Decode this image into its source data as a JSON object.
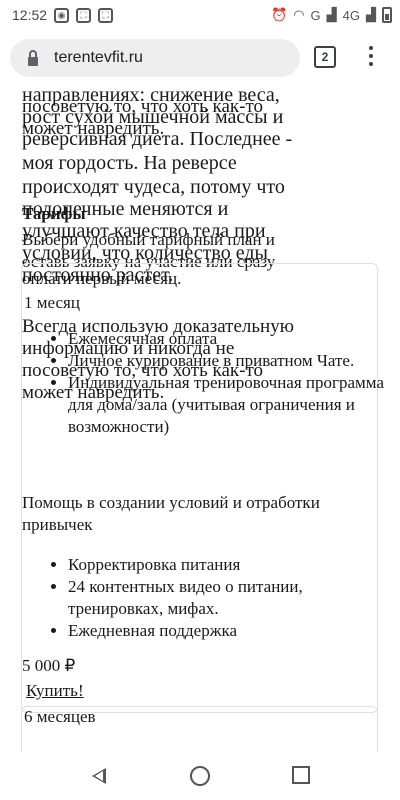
{
  "status_bar": {
    "time": "12:52",
    "carrier_label": "4G",
    "network_label": "G"
  },
  "browser": {
    "url": "terentevfit.ru",
    "tab_count": "2"
  },
  "content": {
    "intro_line_1": "направлениях: снижение веса,",
    "intro_line_2": "рост сухой мышечной массы и",
    "intro_line_3": "реверсивная диета. Последнее -",
    "intro_line_4": "моя гордость. На реверсе",
    "intro_line_5": "происходят чудеса, потому что",
    "intro_line_6": "подопечные меняются и",
    "intro_line_7": "улучшают качество тела при",
    "intro_line_8": "условии, что количество еды",
    "intro_line_9": "постоянно растет.",
    "overlap_1": "посоветую то, что хоть как-то",
    "overlap_2": "может навредить.",
    "tariffs_heading": "Тарифы",
    "tariffs_desc_1": "Выбери удобный тарифный план и",
    "tariffs_desc_2": "оставь заявку на участие или сразу",
    "tariffs_desc_3": "оплати первый месяц.",
    "overlap_3": "Всегда использую доказательную",
    "overlap_4": "информацию и никогда не",
    "overlap_5": "посоветую то, что хоть как-то",
    "overlap_6": "может навредить."
  },
  "plans": [
    {
      "name": "1 месяц",
      "features_a": [
        "Ежемесячная оплата",
        "Личное курирование в приватном Чате.",
        "Индивидуальная тренировочная программа для дома/зала (учитывая ограничения и возможности)"
      ],
      "section_text": "Помощь в создании условий и отработки привычек",
      "features_b": [
        "Корректировка питания",
        "24 контентных видео о питании, тренировках, мифах.",
        "Ежедневная поддержка"
      ],
      "price": "5 000 ₽",
      "buy_label": "Купить!"
    },
    {
      "name": "6 месяцев"
    }
  ]
}
